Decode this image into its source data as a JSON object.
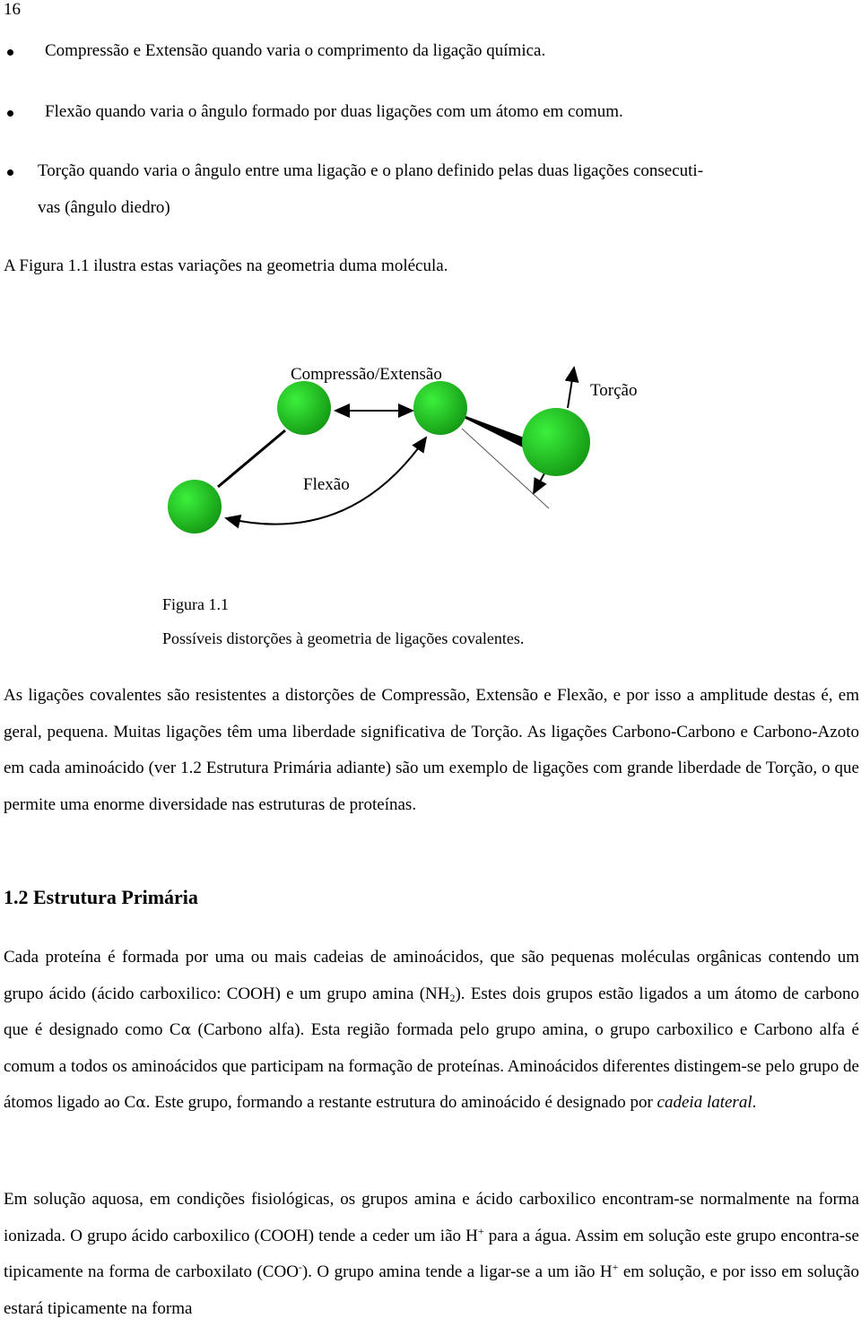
{
  "page": {
    "number": "16",
    "bullets": [
      "Compressão e Extensão quando varia o comprimento da ligação química.",
      "Flexão quando varia o ângulo formado por duas ligações com um átomo em comum.",
      "Torção quando varia o ângulo entre uma ligação e o plano definido pelas duas ligações consecuti-"
    ],
    "bullet3_continuation": "vas (ângulo diedro)",
    "intro": "A Figura 1.1 ilustra estas variações na geometria duma molécula.",
    "figure": {
      "labels": {
        "compression": "Compressão/Extensão",
        "torsion": "Torção",
        "flexion": "Flexão"
      },
      "atom_color": "#22c422",
      "caption_title": "Figura 1.1",
      "caption_text": "Possíveis distorções à geometria de ligações covalentes."
    },
    "paragraph1": "As ligações covalentes são resistentes a distorções de Compressão, Extensão e Flexão, e por isso a amplitude destas é, em geral, pequena. Muitas ligações têm uma liberdade significativa de Torção. As ligações Carbono-Carbono e Carbono-Azoto em cada aminoácido (ver 1.2 Estrutura Primária adiante) são um exemplo de ligações com grande liberdade de Torção, o que permite uma enorme diversidade nas estruturas de proteínas.",
    "section_heading": "1.2 Estrutura Primária",
    "paragraph2": {
      "p1": "Cada proteína é formada por uma ou mais cadeias de aminoácidos, que são pequenas moléculas orgânicas contendo um grupo ácido (ácido carboxilico: COOH) e um grupo amina (NH",
      "sub1": "2",
      "p2": "). Estes dois grupos estão ligados a um átomo de carbono que é designado como C",
      "alpha": "α",
      "p3": " (Carbono alfa). Esta região formada pelo grupo amina, o grupo carboxilico e Carbono alfa é comum a todos os aminoácidos que participam na formação de proteínas. Aminoácidos diferentes distingem-se pelo grupo de átomos ligado ao C",
      "p4": ". Este grupo, formando a restante estrutura do aminoácido é designado por ",
      "italic": "cadeia lateral",
      "p5": "."
    },
    "paragraph3": {
      "p1": "Em solução aquosa, em condições fisiológicas, os grupos amina e ácido carboxilico encontram-se normalmente na forma ionizada. O grupo ácido carboxilico (COOH) tende a ceder um ião H",
      "sup1": "+",
      "p2": " para a água. Assim em solução este grupo encontra-se tipicamente na forma de carboxilato (COO",
      "sup2": "-",
      "p3": "). O grupo amina tende a ligar-se a um ião H",
      "sup3": "+",
      "p4": " em solução, e por isso em solução estará tipicamente na forma"
    }
  }
}
